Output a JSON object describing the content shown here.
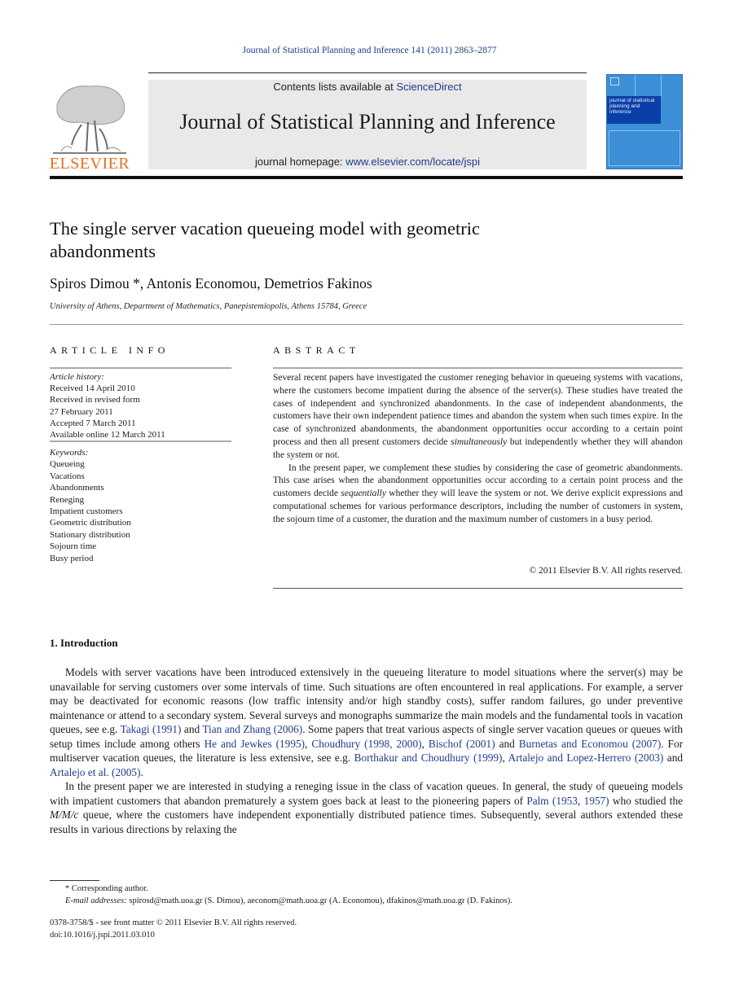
{
  "header": {
    "journal_ref": "Journal of Statistical Planning and Inference 141 (2011) 2863–2877",
    "publisher_logo_text": "ELSEVIER",
    "contents_prefix": "Contents lists available at ",
    "contents_link": "ScienceDirect",
    "journal_title": "Journal of Statistical Planning and Inference",
    "homepage_prefix": "journal homepage: ",
    "homepage_link": "www.elsevier.com/locate/jspi",
    "cover_text": "journal of statistical planning and inference",
    "link_color": "#1f3c8c",
    "logo_color": "#e86f1e"
  },
  "article": {
    "title": "The single server vacation queueing model with geometric abandonments",
    "authors": "Spiros Dimou *, Antonis Economou, Demetrios Fakinos",
    "affiliation": "University of Athens, Department of Mathematics, Panepistemiopolis, Athens 15784, Greece"
  },
  "article_info": {
    "heading": "ARTICLE INFO",
    "history_label": "Article history:",
    "history": [
      "Received 14 April 2010",
      "Received in revised form",
      "27 February 2011",
      "Accepted 7 March 2011",
      "Available online 12 March 2011"
    ],
    "keywords_label": "Keywords:",
    "keywords": [
      "Queueing",
      "Vacations",
      "Abandonments",
      "Reneging",
      "Impatient customers",
      "Geometric distribution",
      "Stationary distribution",
      "Sojourn time",
      "Busy period"
    ]
  },
  "abstract": {
    "heading": "ABSTRACT",
    "p1_a": "Several recent papers have investigated the customer reneging behavior in queueing systems with vacations, where the customers become impatient during the absence of the server(s). These studies have treated the cases of independent and synchronized abandonments. In the case of independent abandonments, the customers have their own independent patience times and abandon the system when such times expire. In the case of synchronized abandonments, the abandonment opportunities occur according to a certain point process and then all present customers decide ",
    "p1_em": "simultaneously",
    "p1_b": " but independently whether they will abandon the system or not.",
    "p2_a": "In the present paper, we complement these studies by considering the case of geometric abandonments. This case arises when the abandonment opportunities occur according to a certain point process and the customers decide ",
    "p2_em": "sequentially",
    "p2_b": " whether they will leave the system or not. We derive explicit expressions and computational schemes for various performance descriptors, including the number of customers in system, the sojourn time of a customer, the duration and the maximum number of customers in a busy period.",
    "copyright": "© 2011 Elsevier B.V. All rights reserved."
  },
  "introduction": {
    "heading": "1.  Introduction",
    "p1": [
      {
        "t": "Models with server vacations have been introduced extensively in the queueing literature to model situations where the server(s) may be unavailable for serving customers over some intervals of time. Such situations are often encountered in real applications. For example, a server may be deactivated for economic reasons (low traffic intensity and/or high standby costs), suffer random failures, go under preventive maintenance or attend to a secondary system. Several surveys and monographs summarize the main models and the fundamental tools in vacation queues, see e.g. "
      },
      {
        "ref": "Takagi (1991)"
      },
      {
        "t": " and "
      },
      {
        "ref": "Tian and Zhang (2006)"
      },
      {
        "t": ". Some papers that treat various aspects of single server vacation queues or queues with setup times include among others "
      },
      {
        "ref": "He and Jewkes (1995)"
      },
      {
        "t": ", "
      },
      {
        "ref": "Choudhury (1998, 2000)"
      },
      {
        "t": ", "
      },
      {
        "ref": "Bischof (2001)"
      },
      {
        "t": " and "
      },
      {
        "ref": "Burnetas and Economou (2007)"
      },
      {
        "t": ". For multiserver vacation queues, the literature is less extensive, see e.g. "
      },
      {
        "ref": "Borthakur and Choudhury (1999)"
      },
      {
        "t": ", "
      },
      {
        "ref": "Artalejo and Lopez-Herrero (2003)"
      },
      {
        "t": " and "
      },
      {
        "ref": "Artalejo et al. (2005)"
      },
      {
        "t": "."
      }
    ],
    "p2": [
      {
        "t": "In the present paper we are interested in studying a reneging issue in the class of vacation queues. In general, the study of queueing models with impatient customers that abandon prematurely a system goes back at least to the pioneering papers of "
      },
      {
        "ref": "Palm (1953"
      },
      {
        "t": ", "
      },
      {
        "ref": "1957)"
      },
      {
        "t": " who studied the "
      },
      {
        "em": "M/M/c"
      },
      {
        "t": " queue, where the customers have independent exponentially distributed patience times. Subsequently, several authors extended these results in various directions by relaxing the"
      }
    ]
  },
  "footnotes": {
    "corresponding": "* Corresponding author.",
    "email_label": "E-mail addresses:",
    "emails": " spirosd@math.uoa.gr (S. Dimou), aeconom@math.uoa.gr (A. Economou), dfakinos@math.uoa.gr (D. Fakinos).",
    "issn": "0378-3758/$ - see front matter © 2011 Elsevier B.V. All rights reserved.",
    "doi": "doi:10.1016/j.jspi.2011.03.010"
  }
}
